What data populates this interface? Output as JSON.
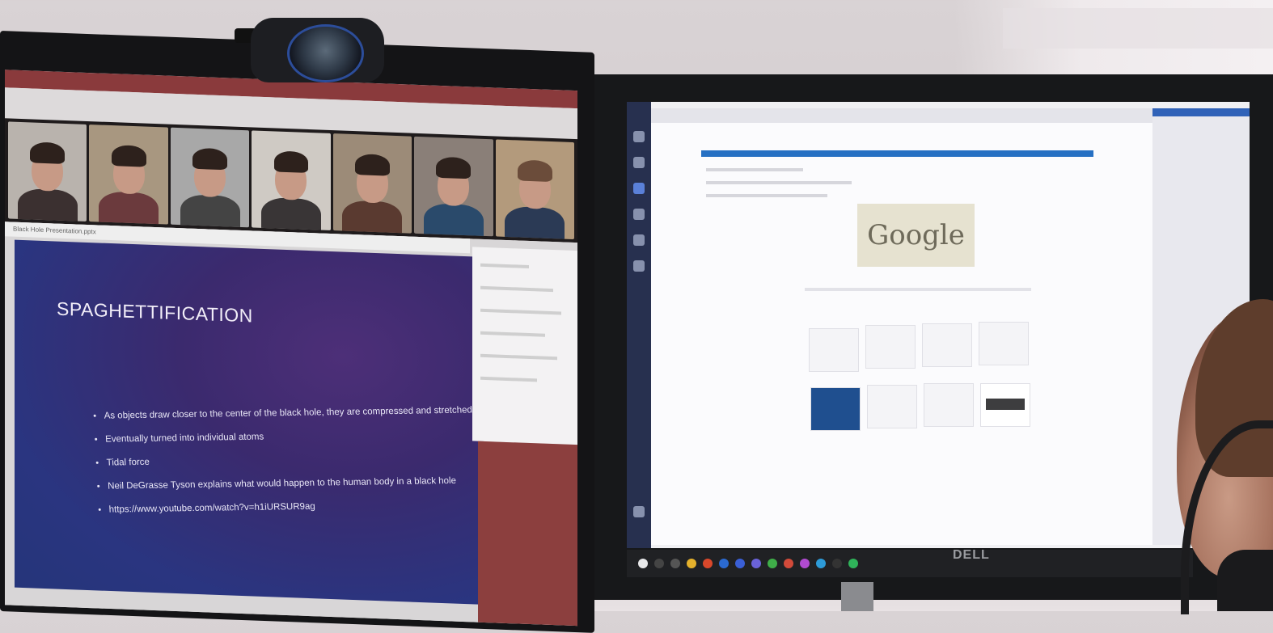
{
  "scene": {
    "description_free": true
  },
  "left_monitor": {
    "slide_title": "SPAGHETTIFICATION",
    "bullets": [
      "As objects draw closer to the center of the black hole, they are compressed and stretched",
      "Eventually turned into individual atoms",
      "Tidal force",
      "Neil DeGrasse Tyson explains what would happen to the human body in a black hole",
      "https://www.youtube.com/watch?v=h1iURSUR9ag"
    ],
    "ppt_title": "Black Hole Presentation.pptx"
  },
  "right_monitor": {
    "brand": "DELL",
    "doodle_text": "Google"
  },
  "colors": {
    "slide_bg": "#3b2a6e",
    "accent_blue": "#2670c3",
    "zoom_red": "#8a3a3c"
  }
}
